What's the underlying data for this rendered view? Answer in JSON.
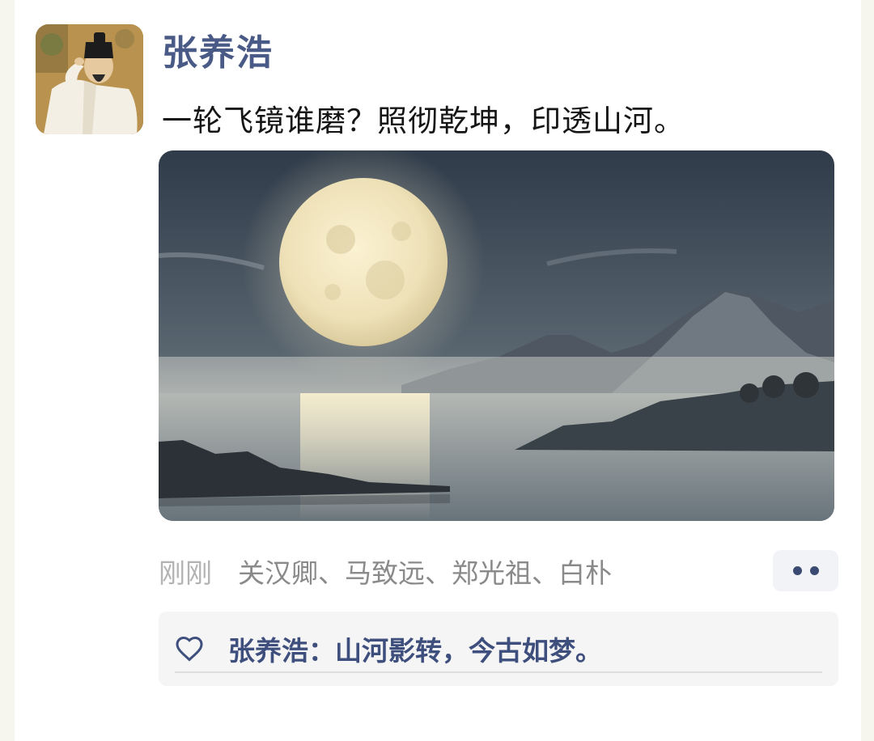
{
  "post": {
    "author": "张养浩",
    "text": "一轮飞镜谁磨？照彻乾坤，印透山河。",
    "time": "刚刚",
    "likes": "关汉卿、马致远、郑光祖、白朴"
  },
  "comment": {
    "text": "张养浩：山河影转，今古如梦。"
  },
  "icons": {
    "avatar": "scholar-portrait",
    "more": "more-dots-icon",
    "like": "heart-icon"
  },
  "colors": {
    "author": "#4a5a86",
    "accent": "#3b4a72"
  }
}
